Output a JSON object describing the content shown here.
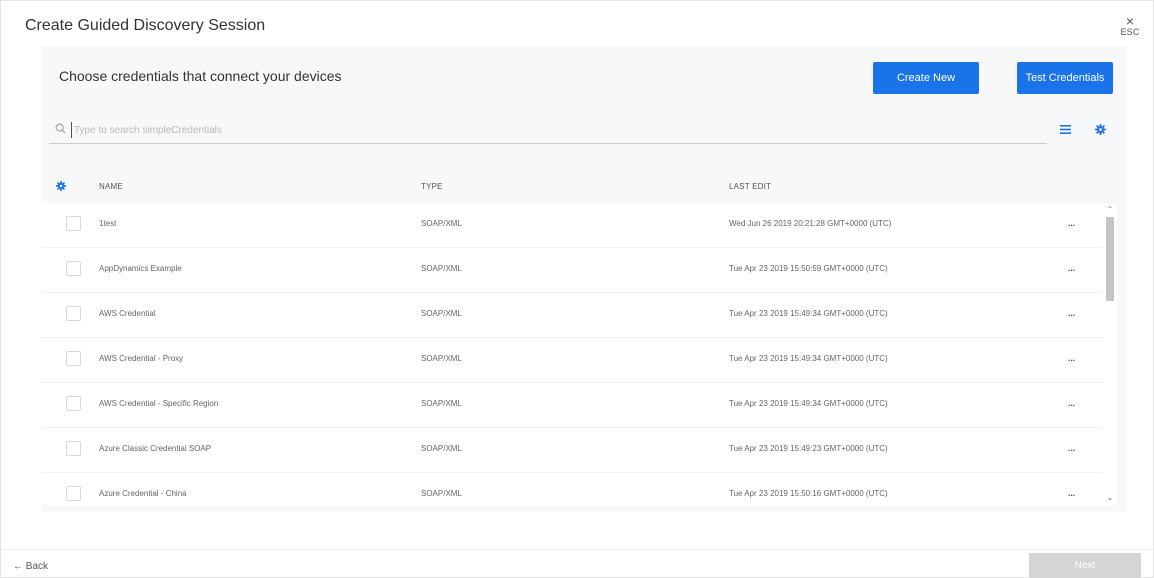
{
  "window": {
    "title": "Create Guided Discovery Session",
    "close_glyph": "×",
    "esc_label": "ESC"
  },
  "panel": {
    "subtitle": "Choose credentials that connect your devices",
    "create_new_label": "Create New",
    "test_credentials_label": "Test Credentials"
  },
  "search": {
    "placeholder": "Type to search simpleCredentials",
    "value": ""
  },
  "table": {
    "headers": {
      "name": "NAME",
      "type": "TYPE",
      "last_edit": "LAST EDIT"
    },
    "rows": [
      {
        "name": "1test",
        "type": "SOAP/XML",
        "last_edit": "Wed Jun 26 2019 20:21:28 GMT+0000 (UTC)",
        "action": "..."
      },
      {
        "name": "AppDynamics Example",
        "type": "SOAP/XML",
        "last_edit": "Tue Apr 23 2019 15:50:59 GMT+0000 (UTC)",
        "action": "..."
      },
      {
        "name": "AWS Credential",
        "type": "SOAP/XML",
        "last_edit": "Tue Apr 23 2019 15:49:34 GMT+0000 (UTC)",
        "action": "..."
      },
      {
        "name": "AWS Credential - Proxy",
        "type": "SOAP/XML",
        "last_edit": "Tue Apr 23 2019 15:49:34 GMT+0000 (UTC)",
        "action": "..."
      },
      {
        "name": "AWS Credential - Specific Region",
        "type": "SOAP/XML",
        "last_edit": "Tue Apr 23 2019 15:49:34 GMT+0000 (UTC)",
        "action": "..."
      },
      {
        "name": "Azure Classic Credential SOAP",
        "type": "SOAP/XML",
        "last_edit": "Tue Apr 23 2019 15:49:23 GMT+0000 (UTC)",
        "action": "..."
      },
      {
        "name": "Azure Credential - China",
        "type": "SOAP/XML",
        "last_edit": "Tue Apr 23 2019 15:50:16 GMT+0000 (UTC)",
        "action": "..."
      }
    ]
  },
  "footer": {
    "back_label": "← Back",
    "next_label": "Next"
  },
  "icons": {
    "search": "search-icon",
    "list": "list-view-icon",
    "settings": "gear-icon",
    "column_settings": "column-settings-icon"
  },
  "colors": {
    "accent": "#1a73e8",
    "disabled": "#d4d5d7",
    "panel_bg": "#f7f8fa"
  }
}
